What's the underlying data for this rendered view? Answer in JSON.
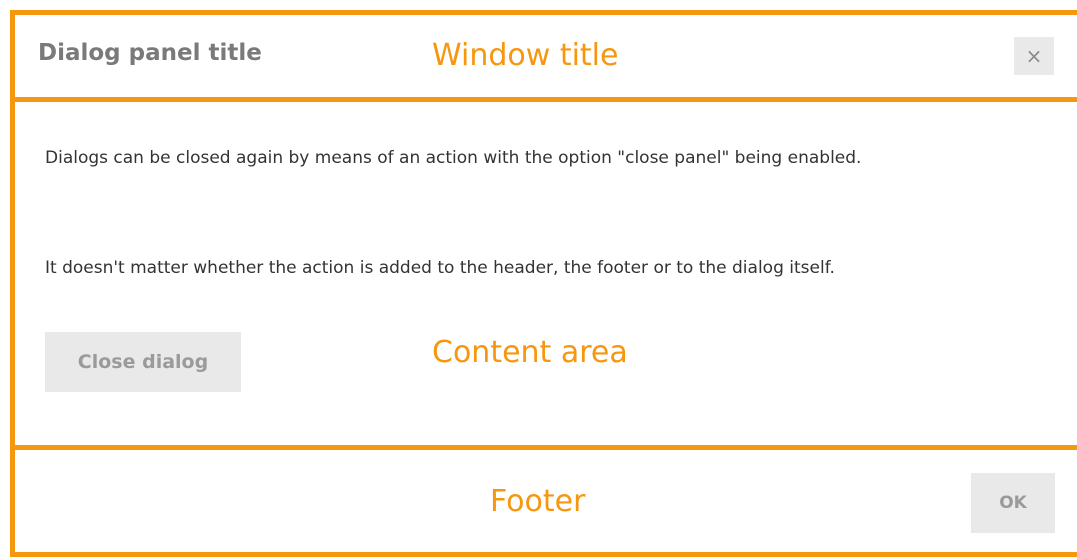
{
  "dialog": {
    "title": "Dialog panel title",
    "close_icon": "close-icon",
    "close_glyph": "×",
    "paragraphs": [
      "Dialogs can be closed again by means of an action with the option \"close panel\" being enabled.",
      "It doesn't matter whether the action is added to the header, the footer or to the dialog itself."
    ],
    "close_dialog_label": "Close dialog",
    "ok_label": "OK"
  },
  "annotations": {
    "window_title": "Window title",
    "content_area": "Content area",
    "footer": "Footer"
  },
  "colors": {
    "annotation": "#f7960f",
    "button_bg": "#e9e9e9",
    "title_text": "#7a7a7a",
    "body_text": "#333333"
  }
}
